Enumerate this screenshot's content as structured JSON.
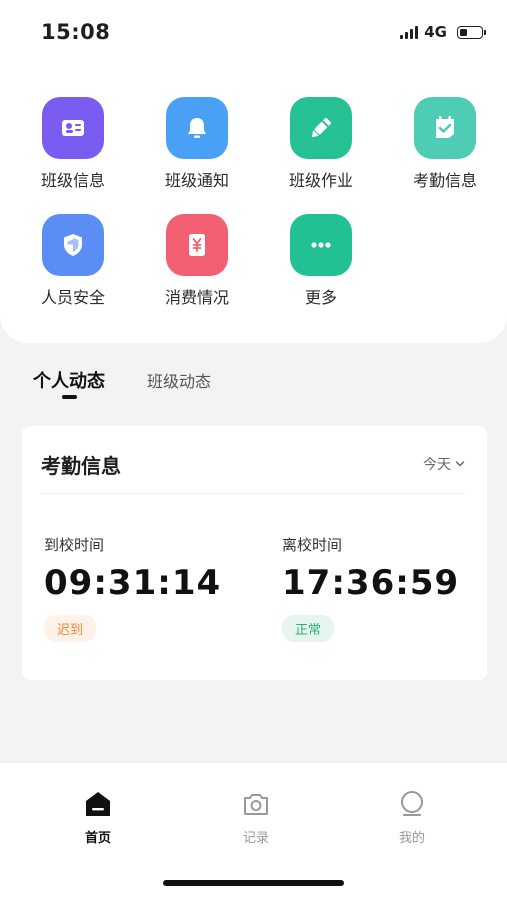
{
  "status_bar": {
    "time": "15:08",
    "network": "4G",
    "battery_level": 0.35
  },
  "grid": [
    {
      "label": "班级信息",
      "icon": "class-info-icon",
      "color": "#7b5cf0"
    },
    {
      "label": "班级通知",
      "icon": "bell-icon",
      "color": "#4aa0f5"
    },
    {
      "label": "班级作业",
      "icon": "pencil-icon",
      "color": "#25c195"
    },
    {
      "label": "考勤信息",
      "icon": "attendance-check-icon",
      "color": "#4fcdb4"
    },
    {
      "label": "人员安全",
      "icon": "shield-icon",
      "color": "#5b8ef5"
    },
    {
      "label": "消费情况",
      "icon": "yuan-icon",
      "color": "#f35f72"
    },
    {
      "label": "更多",
      "icon": "more-dots-icon",
      "color": "#22c193"
    }
  ],
  "tabs": {
    "active": "个人动态",
    "inactive": "班级动态"
  },
  "attendance": {
    "title": "考勤信息",
    "filter": "今天",
    "arrival_label": "到校时间",
    "arrival_time": "09:31:14",
    "arrival_status": "迟到",
    "departure_label": "离校时间",
    "departure_time": "17:36:59",
    "departure_status": "正常"
  },
  "bottom_nav": {
    "home": "首页",
    "records": "记录",
    "mine": "我的"
  }
}
